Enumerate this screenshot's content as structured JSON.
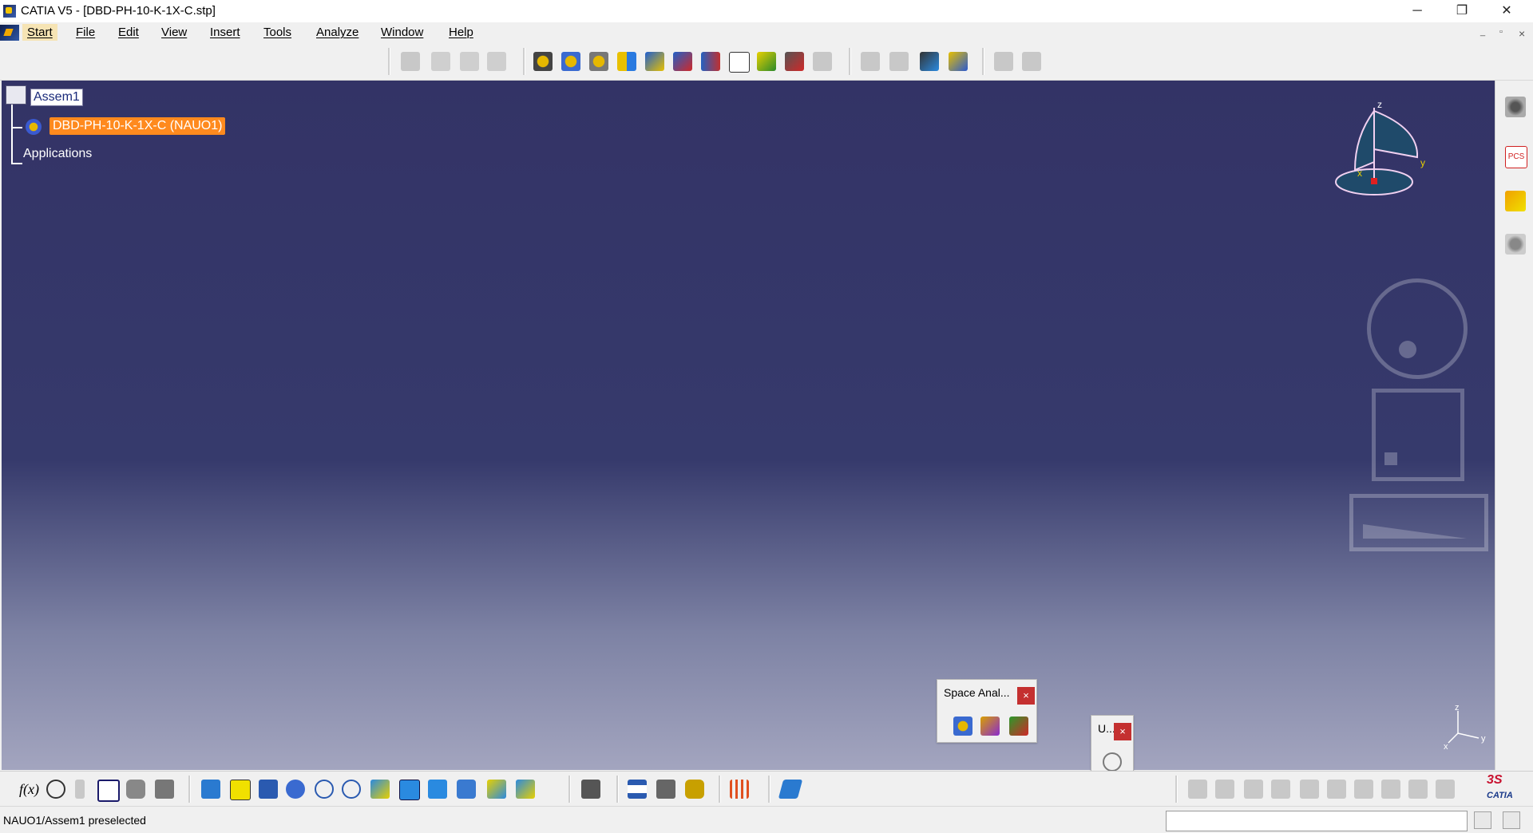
{
  "window": {
    "title": "CATIA V5 - [DBD-PH-10-K-1X-C.stp]",
    "minimize": "─",
    "restore": "❐",
    "close": "✕"
  },
  "menu": {
    "items": [
      "Start",
      "File",
      "Edit",
      "View",
      "Insert",
      "Tools",
      "Analyze",
      "Window",
      "Help"
    ],
    "mdi_min": "_",
    "mdi_restore": "▫",
    "mdi_close": "×"
  },
  "tree": {
    "root_label": "Assem1",
    "child_label": "DBD-PH-10-K-1X-C (NAUO1)",
    "apps_label": "Applications"
  },
  "compass": {
    "axis_z": "z",
    "axis_y": "y",
    "axis_x": "x"
  },
  "axis_triad": {
    "z": "z",
    "y": "y",
    "x": "x"
  },
  "space_analysis_toolbar": {
    "title": "Space Anal...",
    "close": "×"
  },
  "u_toolbar": {
    "title": "U...",
    "close": "×"
  },
  "bottom_toolbar": {
    "formula_label": "f(x)"
  },
  "brand": {
    "catia_text": "CATIA",
    "ds_text": "3S"
  },
  "status": {
    "message": "NAUO1/Assem1 preselected",
    "command_input": ""
  },
  "colors": {
    "viewport_top": "#333366",
    "viewport_bottom": "#a3a5bf",
    "selection_orange": "#ff8a1e",
    "close_red": "#c43030"
  }
}
